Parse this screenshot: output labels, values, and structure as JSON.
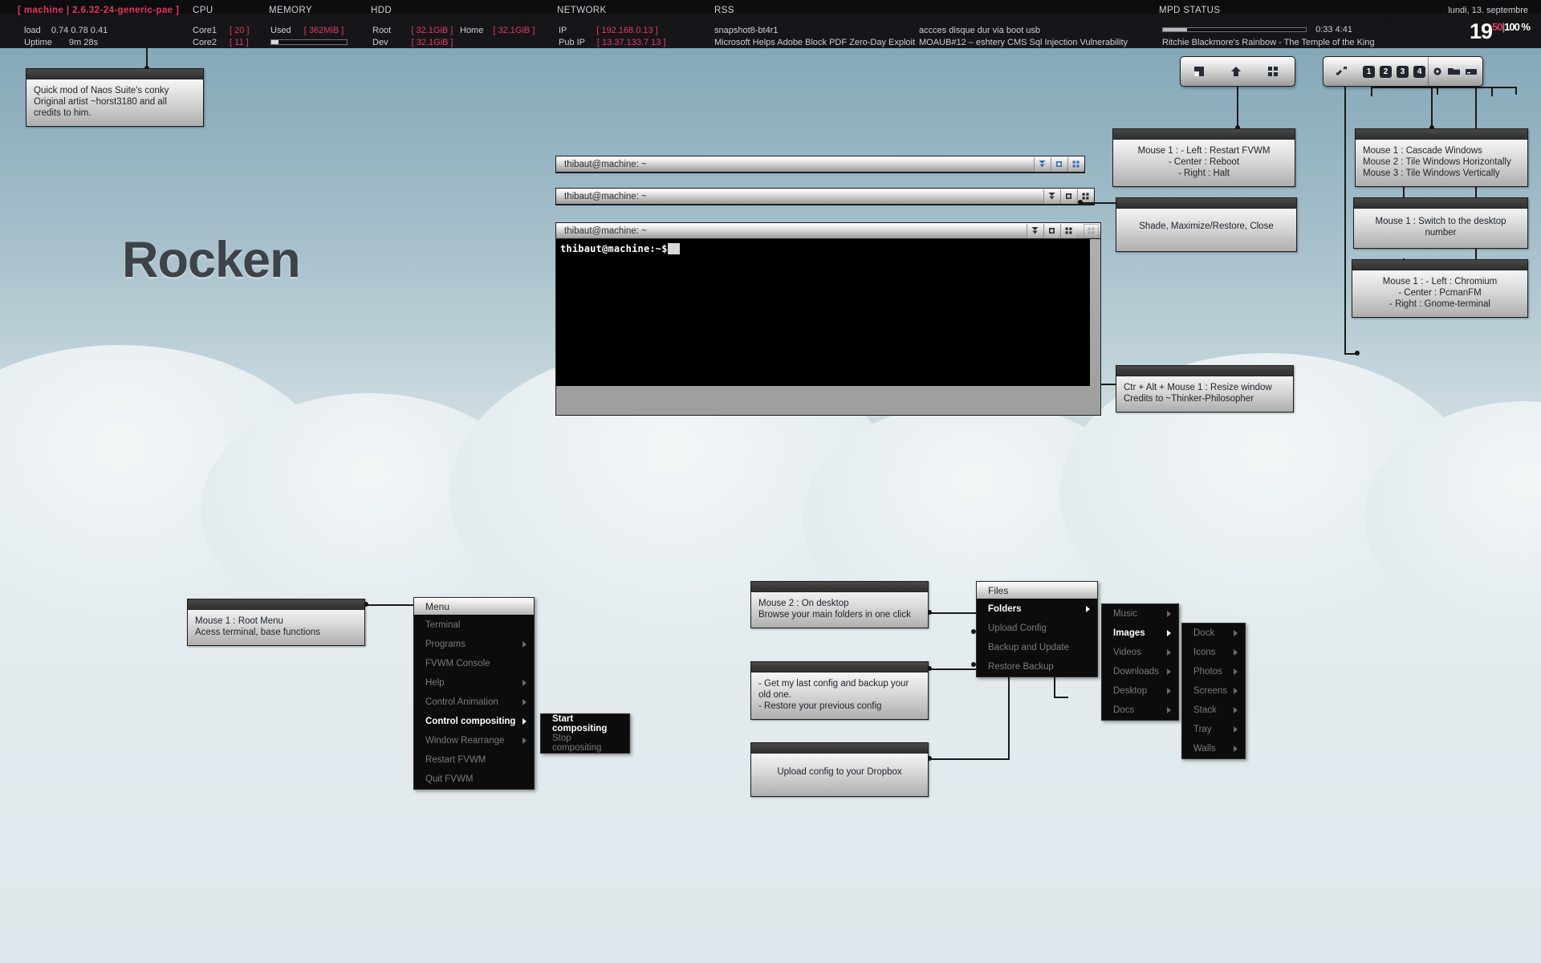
{
  "conky": {
    "host_label": "[ machine | 2.6.32-24-generic-pae ]",
    "sections": {
      "cpu": "CPU",
      "memory": "MEMORY",
      "hdd": "HDD",
      "network": "NETWORK",
      "rss": "RSS",
      "mpd": "MPD STATUS"
    },
    "load_label": "load",
    "load_value": "0.74 0.78 0.41",
    "uptime_label": "Uptime",
    "uptime_value": "9m 28s",
    "core1_label": "Core1",
    "core1_value": "[ 20 ]",
    "core2_label": "Core2",
    "core2_value": "[ 11 ]",
    "mem_used_label": "Used",
    "mem_used_value": "[ 362MiB ]",
    "hdd_root_label": "Root",
    "hdd_root_value": "[ 32.1GiB ]",
    "hdd_dev_label": "Dev",
    "hdd_dev_value": "[ 32.1GiB ]",
    "hdd_home_label": "Home",
    "hdd_home_value": "[ 32.1GiB ]",
    "ip_label": "IP",
    "ip_value": "[ 192.168.0.13 ]",
    "pubip_label": "Pub IP",
    "pubip_value": "[ 13.37.133.7 13 ]",
    "rss": [
      "snapshot8-bt4r1",
      "Microsoft Helps Adobe Block PDF Zero-Day Exploit",
      "accces disque dur via boot usb",
      "MOAUB#12 – eshtery CMS Sql Injection Vulnerability"
    ],
    "mpd_time": "0:33 4:41",
    "mpd_track": "Ritchie Blackmore's Rainbow - The Temple of the King",
    "date": "lundi,  13. septembre",
    "clock_hour": "19",
    "clock_min": "50",
    "clock_sep": "|",
    "clock_battery": "100 %"
  },
  "wallpaper_text": "Rocken",
  "tips": {
    "conky_credit": [
      "Quick mod of Naos Suite's conky",
      "Original artist ~horst3180 and all",
      "credits to him."
    ],
    "restart_fvwm": [
      "Mouse 1 : - Left : Restart FVWM",
      "- Center : Reboot",
      "- Right : Halt"
    ],
    "shade_max_close": [
      "Shade, Maximize/Restore, Close"
    ],
    "cascade_tile": [
      "Mouse 1 : Cascade Windows",
      "Mouse 2 : Tile Windows Horizontally",
      "Mouse 3 : Tile Windows Vertically"
    ],
    "switch_desktop": [
      "Mouse 1 : Switch to the desktop",
      "number"
    ],
    "launchers": [
      "Mouse 1 : - Left : Chromium",
      "- Center : PcmanFM",
      "- Right : Gnome-terminal"
    ],
    "resize_window": [
      "Ctr + Alt + Mouse 1 : Resize window",
      "Credits to ~Thinker-Philosopher"
    ],
    "root_menu": [
      "Mouse 1 : Root Menu",
      "Acess terminal, base functions"
    ],
    "mouse2_desktop": [
      "Mouse 2 : On desktop",
      "Browse your main folders in one click"
    ],
    "backup_restore": [
      "- Get my last config and backup your",
      "old one.",
      "- Restore your previous config"
    ],
    "dropbox": [
      "Upload config to your Dropbox"
    ]
  },
  "windows": [
    {
      "title": "thibaut@machine: ~",
      "buttons": [
        "shade-icon",
        "maximize-icon",
        "close-icon"
      ],
      "focused": true
    },
    {
      "title": "thibaut@machine: ~",
      "buttons": [
        "shade-icon",
        "maximize-icon",
        "close-icon"
      ],
      "focused": false
    },
    {
      "title": "thibaut@machine: ~",
      "buttons": [
        "shade-icon",
        "maximize-icon",
        "close-icon"
      ],
      "focused": false
    }
  ],
  "terminal": {
    "prompt": "thibaut@machine:~$",
    "cursor": " "
  },
  "toolbars": {
    "left_bar": [
      {
        "name": "minimize-all-icon"
      },
      {
        "name": "up-arrow-icon"
      },
      {
        "name": "grid-icon"
      }
    ],
    "right_bar": {
      "rearrange": {
        "name": "rearrange-windows-icon"
      },
      "desktops": [
        "1",
        "2",
        "3",
        "4"
      ],
      "launchers": [
        {
          "name": "chromium-icon"
        },
        {
          "name": "file-manager-icon"
        },
        {
          "name": "terminal-icon"
        }
      ]
    }
  },
  "menus": {
    "root": {
      "title": "Menu",
      "items": [
        {
          "label": "Terminal",
          "submenu": false,
          "active": false
        },
        {
          "label": "Programs",
          "submenu": true,
          "active": false
        },
        {
          "label": "FVWM Console",
          "submenu": false,
          "active": false
        },
        {
          "label": "Help",
          "submenu": true,
          "active": false
        },
        {
          "label": "Control Animation",
          "submenu": true,
          "active": false
        },
        {
          "label": "Control compositing",
          "submenu": true,
          "active": true
        },
        {
          "label": "Window Rearrange",
          "submenu": true,
          "active": false
        },
        {
          "label": "Restart FVWM",
          "submenu": false,
          "active": false
        },
        {
          "label": "Quit FVWM",
          "submenu": false,
          "active": false
        }
      ]
    },
    "compositing": {
      "items": [
        {
          "label": "Start compositing",
          "submenu": false,
          "active": true
        },
        {
          "label": "Stop compositing",
          "submenu": false,
          "active": false
        }
      ]
    },
    "files": {
      "title": "Files",
      "items": [
        {
          "label": "Folders",
          "submenu": true,
          "active": true
        },
        {
          "label": "Upload Config",
          "submenu": false,
          "active": false
        },
        {
          "label": "Backup and Update",
          "submenu": false,
          "active": false
        },
        {
          "label": "Restore Backup",
          "submenu": false,
          "active": false
        }
      ]
    },
    "folders": {
      "items": [
        {
          "label": "Music",
          "submenu": true,
          "active": false
        },
        {
          "label": "Images",
          "submenu": true,
          "active": true
        },
        {
          "label": "Videos",
          "submenu": true,
          "active": false
        },
        {
          "label": "Downloads",
          "submenu": true,
          "active": false
        },
        {
          "label": "Desktop",
          "submenu": true,
          "active": false
        },
        {
          "label": "Docs",
          "submenu": true,
          "active": false
        }
      ]
    },
    "images": {
      "items": [
        {
          "label": "Dock",
          "submenu": true,
          "active": false
        },
        {
          "label": "Icons",
          "submenu": true,
          "active": false
        },
        {
          "label": "Photos",
          "submenu": true,
          "active": false
        },
        {
          "label": "Screens",
          "submenu": true,
          "active": false
        },
        {
          "label": "Stack",
          "submenu": true,
          "active": false
        },
        {
          "label": "Tray",
          "submenu": true,
          "active": false
        },
        {
          "label": "Walls",
          "submenu": true,
          "active": false
        }
      ]
    }
  },
  "colors": {
    "accent_pink": "#e8365f",
    "conky_bg": "#0d0d10",
    "menu_bg": "#0c0c0c",
    "desktop_top": "#7ea3b5",
    "desktop_bottom": "#dde6ea"
  }
}
